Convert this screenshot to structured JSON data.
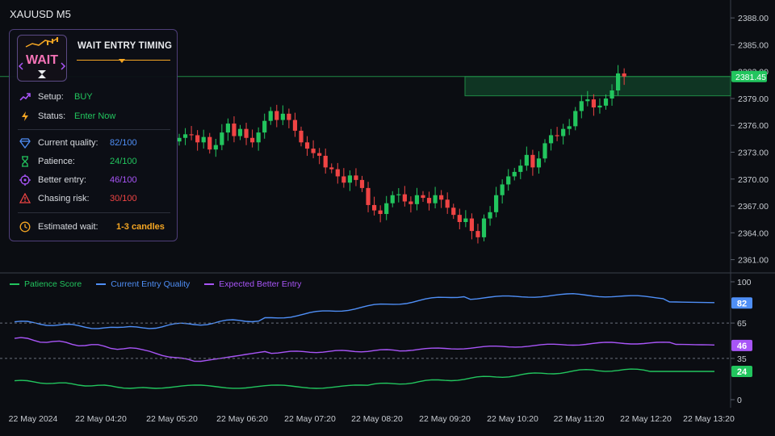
{
  "symbol": "XAUUSD M5",
  "panel": {
    "title": "WAIT ENTRY TIMING",
    "logo_text": "WAIT",
    "setup": {
      "label": "Setup:",
      "value": "BUY",
      "color": "#22c55e"
    },
    "status": {
      "label": "Status:",
      "value": "Enter Now",
      "color": "#22c55e"
    },
    "metrics": [
      {
        "label": "Current quality:",
        "value": "82/100",
        "color": "#4f8ff7",
        "icon": "diamond-icon"
      },
      {
        "label": "Patience:",
        "value": "24/100",
        "color": "#22c55e",
        "icon": "hourglass-icon"
      },
      {
        "label": "Better entry:",
        "value": "46/100",
        "color": "#a855f7",
        "icon": "crosshair-icon"
      },
      {
        "label": "Chasing risk:",
        "value": "30/100",
        "color": "#ef4444",
        "icon": "warning-icon"
      }
    ],
    "wait": {
      "label": "Estimated wait:",
      "value": "1-3 candles",
      "color": "#f5a623",
      "icon": "clock-icon"
    }
  },
  "price_axis": {
    "ticks": [
      "2388.00",
      "2385.00",
      "2382.00",
      "2379.00",
      "2376.00",
      "2373.00",
      "2370.00",
      "2367.00",
      "2364.00",
      "2361.00"
    ],
    "current_price": "2381.45"
  },
  "time_axis": [
    "22 May 2024",
    "22 May 04:20",
    "22 May 05:20",
    "22 May 06:20",
    "22 May 07:20",
    "22 May 08:20",
    "22 May 09:20",
    "22 May 10:20",
    "22 May 11:20",
    "22 May 12:20",
    "22 May 13:20"
  ],
  "indicator": {
    "legend": [
      {
        "name": "Patience Score",
        "color": "#22c55e"
      },
      {
        "name": "Current Entry Quality",
        "color": "#4f8ff7"
      },
      {
        "name": "Expected Better Entry",
        "color": "#a855f7"
      }
    ],
    "axis_ticks": [
      "100",
      "65",
      "35",
      "0"
    ],
    "levels": [
      65,
      35
    ],
    "last_values": [
      "82",
      "46",
      "24"
    ]
  },
  "colors": {
    "up": "#22c55e",
    "down": "#ef4444",
    "background": "#0b0d12"
  },
  "chart_data": {
    "type": "candlestick",
    "candles_close": [
      2374.6,
      2375.0,
      2374.9,
      2374.1,
      2374.7,
      2373.3,
      2373.8,
      2375.2,
      2376.2,
      2374.8,
      2375.6,
      2374.6,
      2374.1,
      2375.2,
      2376.5,
      2377.6,
      2376.6,
      2377.3,
      2376.6,
      2375.4,
      2374.1,
      2373.4,
      2372.9,
      2372.6,
      2371.3,
      2371.1,
      2370.3,
      2369.6,
      2370.4,
      2369.9,
      2369.0,
      2367.1,
      2366.5,
      2366.1,
      2367.3,
      2368.2,
      2368.3,
      2367.5,
      2367.2,
      2368.2,
      2367.9,
      2367.3,
      2368.2,
      2367.7,
      2366.8,
      2366.0,
      2365.2,
      2365.6,
      2364.2,
      2363.5,
      2365.6,
      2366.3,
      2368.2,
      2369.4,
      2370.3,
      2370.8,
      2371.5,
      2372.7,
      2371.3,
      2372.3,
      2374.0,
      2374.9,
      2374.8,
      2375.6,
      2375.9,
      2377.6,
      2378.7,
      2378.9,
      2378.0,
      2378.2,
      2379.0,
      2379.9,
      2381.8,
      2381.45
    ],
    "price_range": [
      2359.7,
      2390.0
    ]
  }
}
